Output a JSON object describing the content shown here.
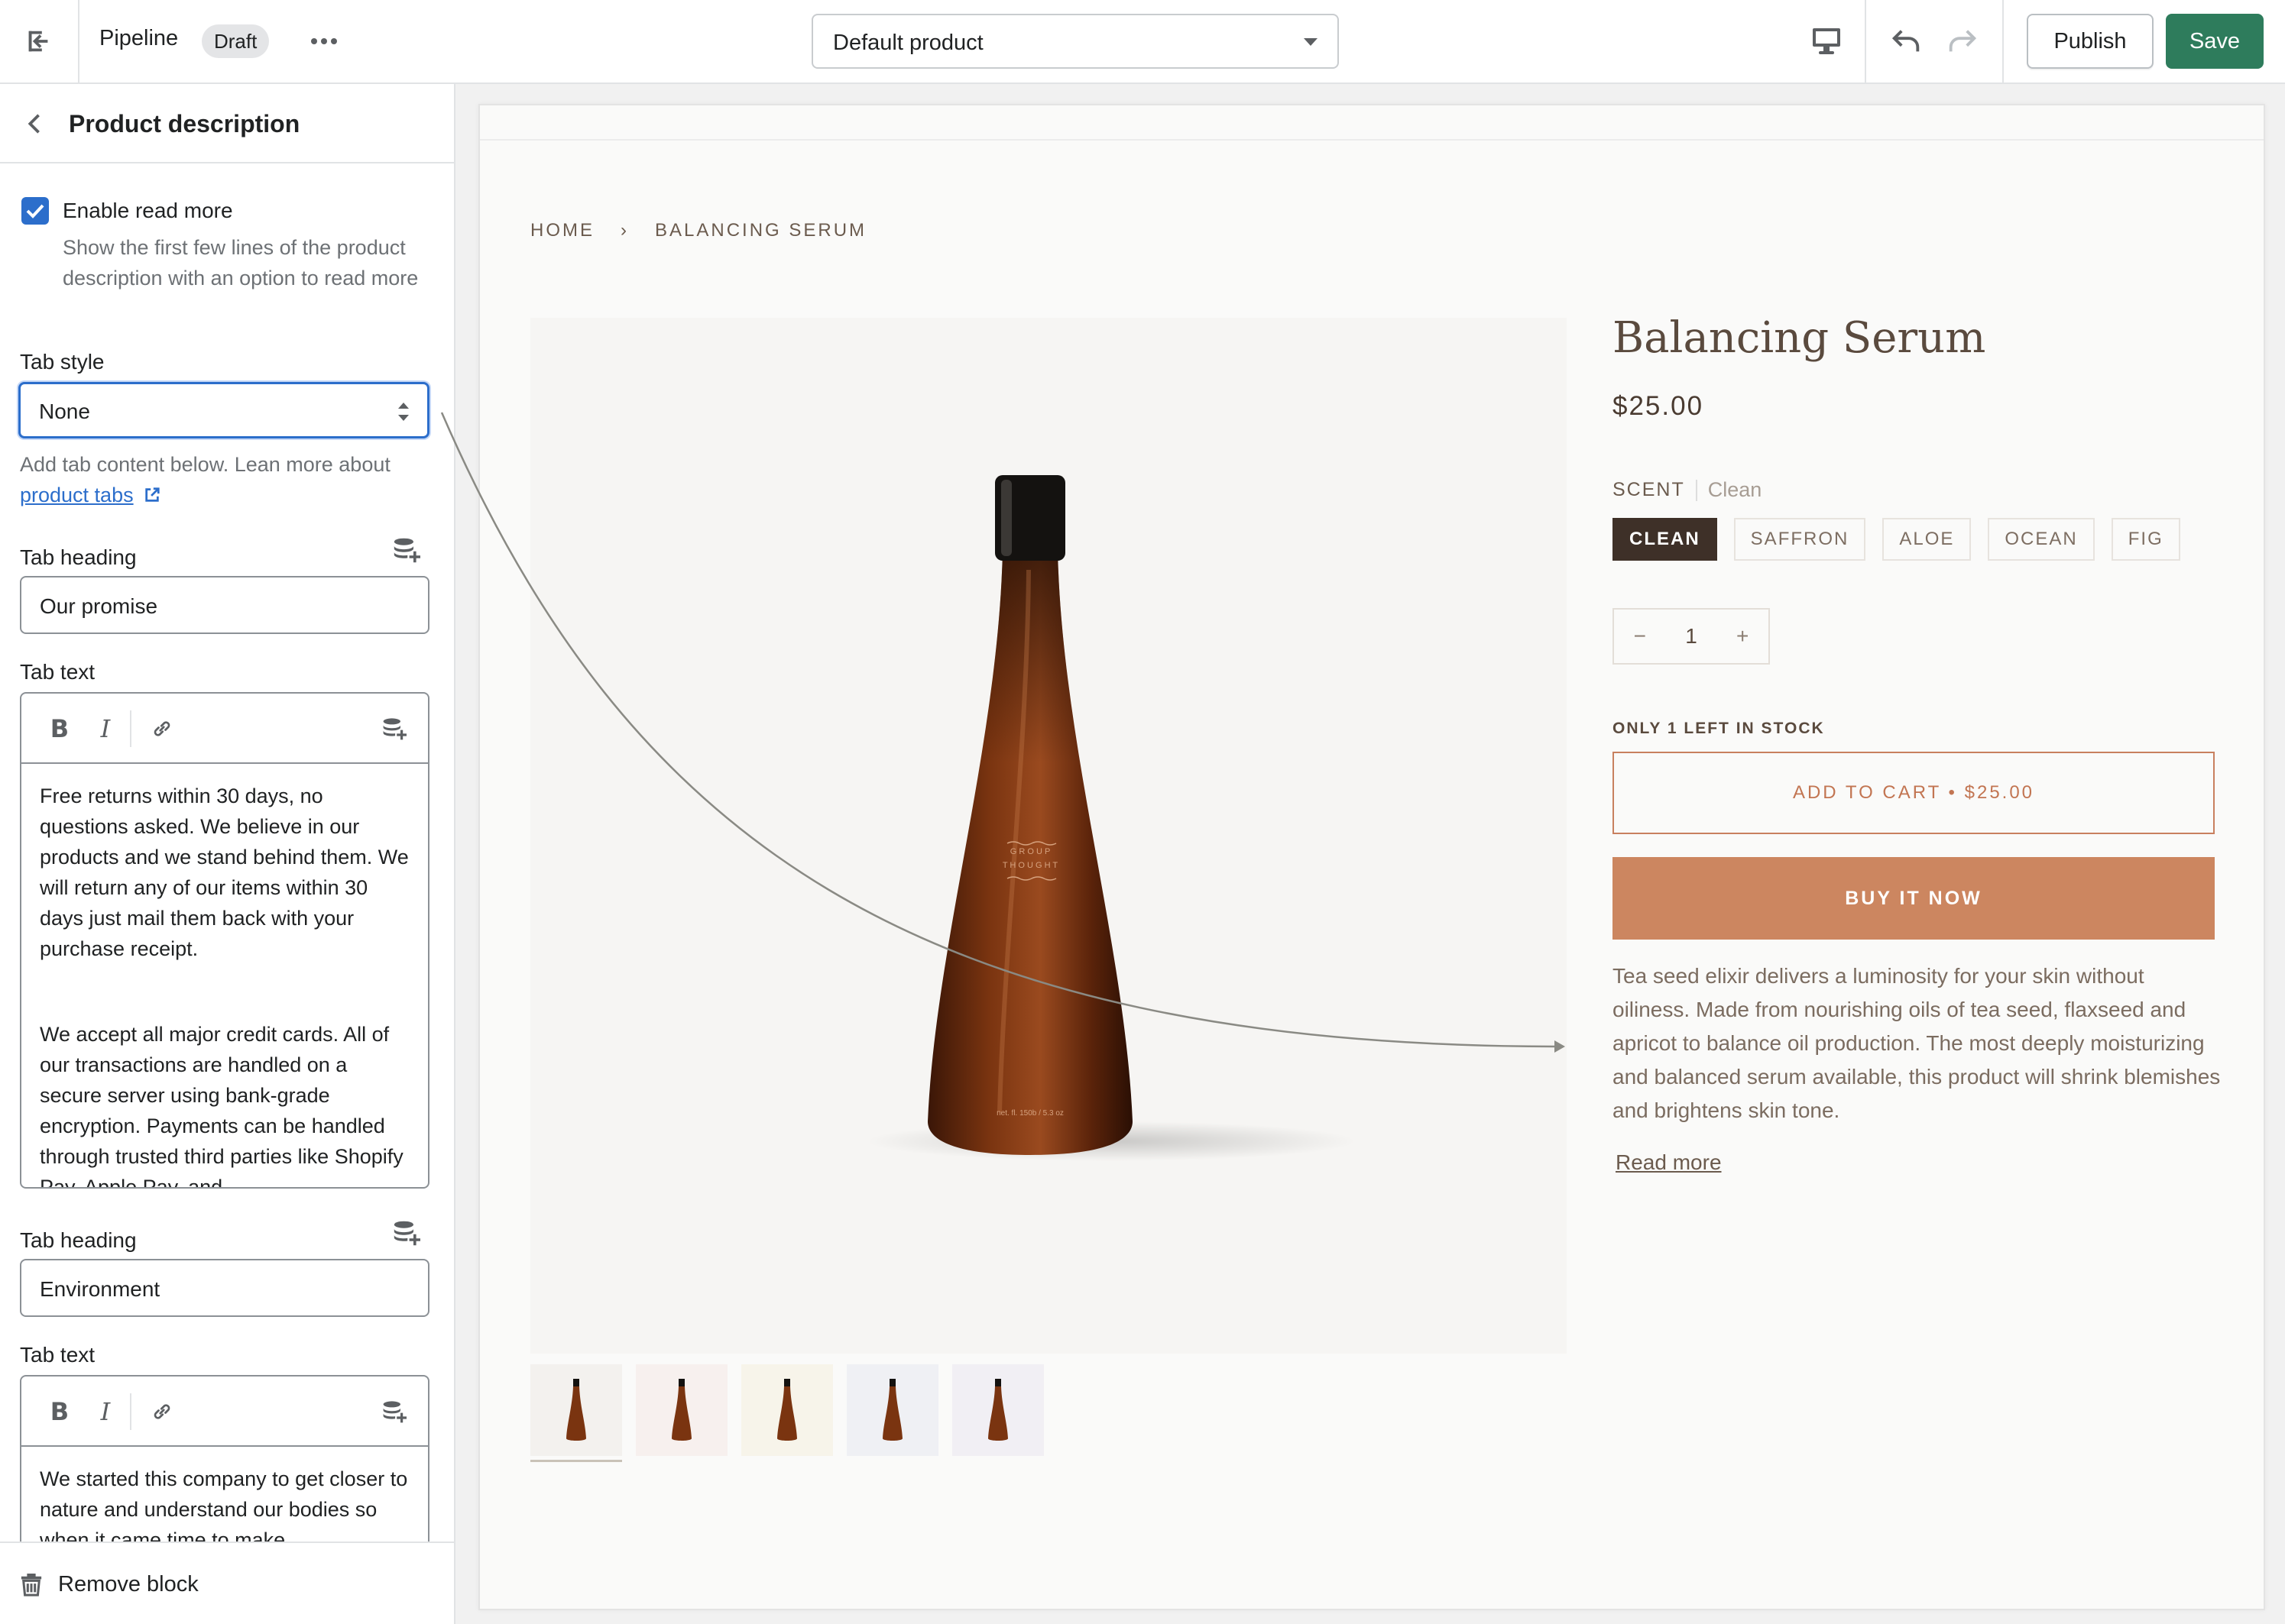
{
  "topbar": {
    "theme_name": "Pipeline",
    "status_badge": "Draft",
    "template_select": "Default product",
    "publish_label": "Publish",
    "save_label": "Save",
    "save_color": "#2e7c5c"
  },
  "sidebar": {
    "title": "Product description",
    "read_more": {
      "checked": true,
      "label": "Enable read more",
      "help": "Show the first few lines of the product description with an option to read more"
    },
    "tab_style": {
      "label": "Tab style",
      "value": "None",
      "help_prefix": "Add tab content below. Lean more about ",
      "help_link": "product tabs"
    },
    "tabs": [
      {
        "heading_label": "Tab heading",
        "heading_value": "Our promise",
        "text_label": "Tab text",
        "paragraphs": [
          "Free returns within 30 days, no questions asked.  We believe in our products and we stand behind them.  We will return any of our items within 30 days just mail them back with your purchase receipt.",
          "We accept all major credit cards.  All of our transactions are handled on a secure server using bank-grade encryption.  Payments can be handled through trusted third parties like Shopify Pay, Apple Pay, and"
        ]
      },
      {
        "heading_label": "Tab heading",
        "heading_value": "Environment",
        "text_label": "Tab text",
        "paragraphs": [
          "We started this company to get closer to nature and understand our bodies so when it came time to make"
        ]
      }
    ],
    "toolbar": {
      "bold": "B",
      "italic": "I"
    },
    "remove_block": "Remove block"
  },
  "preview": {
    "breadcrumb": {
      "home": "HOME",
      "separator": "›",
      "current": "BALANCING SERUM"
    },
    "bottle_label": {
      "brand_line1": "G R O U P",
      "brand_line2": "T H O U G H T",
      "volume": "net. fl. 150b  /  5.3 oz"
    },
    "product": {
      "title": "Balancing Serum",
      "price": "$25.00",
      "scent_label": "SCENT",
      "scent_selected": "Clean",
      "scents": [
        "CLEAN",
        "SAFFRON",
        "ALOE",
        "OCEAN",
        "FIG"
      ],
      "quantity": "1",
      "qty_minus": "−",
      "qty_plus": "+",
      "stock": "ONLY 1 LEFT IN STOCK",
      "add_to_cart": "ADD TO CART • $25.00",
      "buy_now": "BUY IT NOW",
      "description": "Tea seed elixir delivers a luminosity for your skin without oiliness. Made from nourishing oils of tea seed, flaxseed and apricot to balance oil production.  The most deeply moisturizing and balanced serum available, this product will shrink blemishes and brightens skin tone.",
      "read_more": "Read more"
    },
    "accent_color": "#cc8660"
  }
}
